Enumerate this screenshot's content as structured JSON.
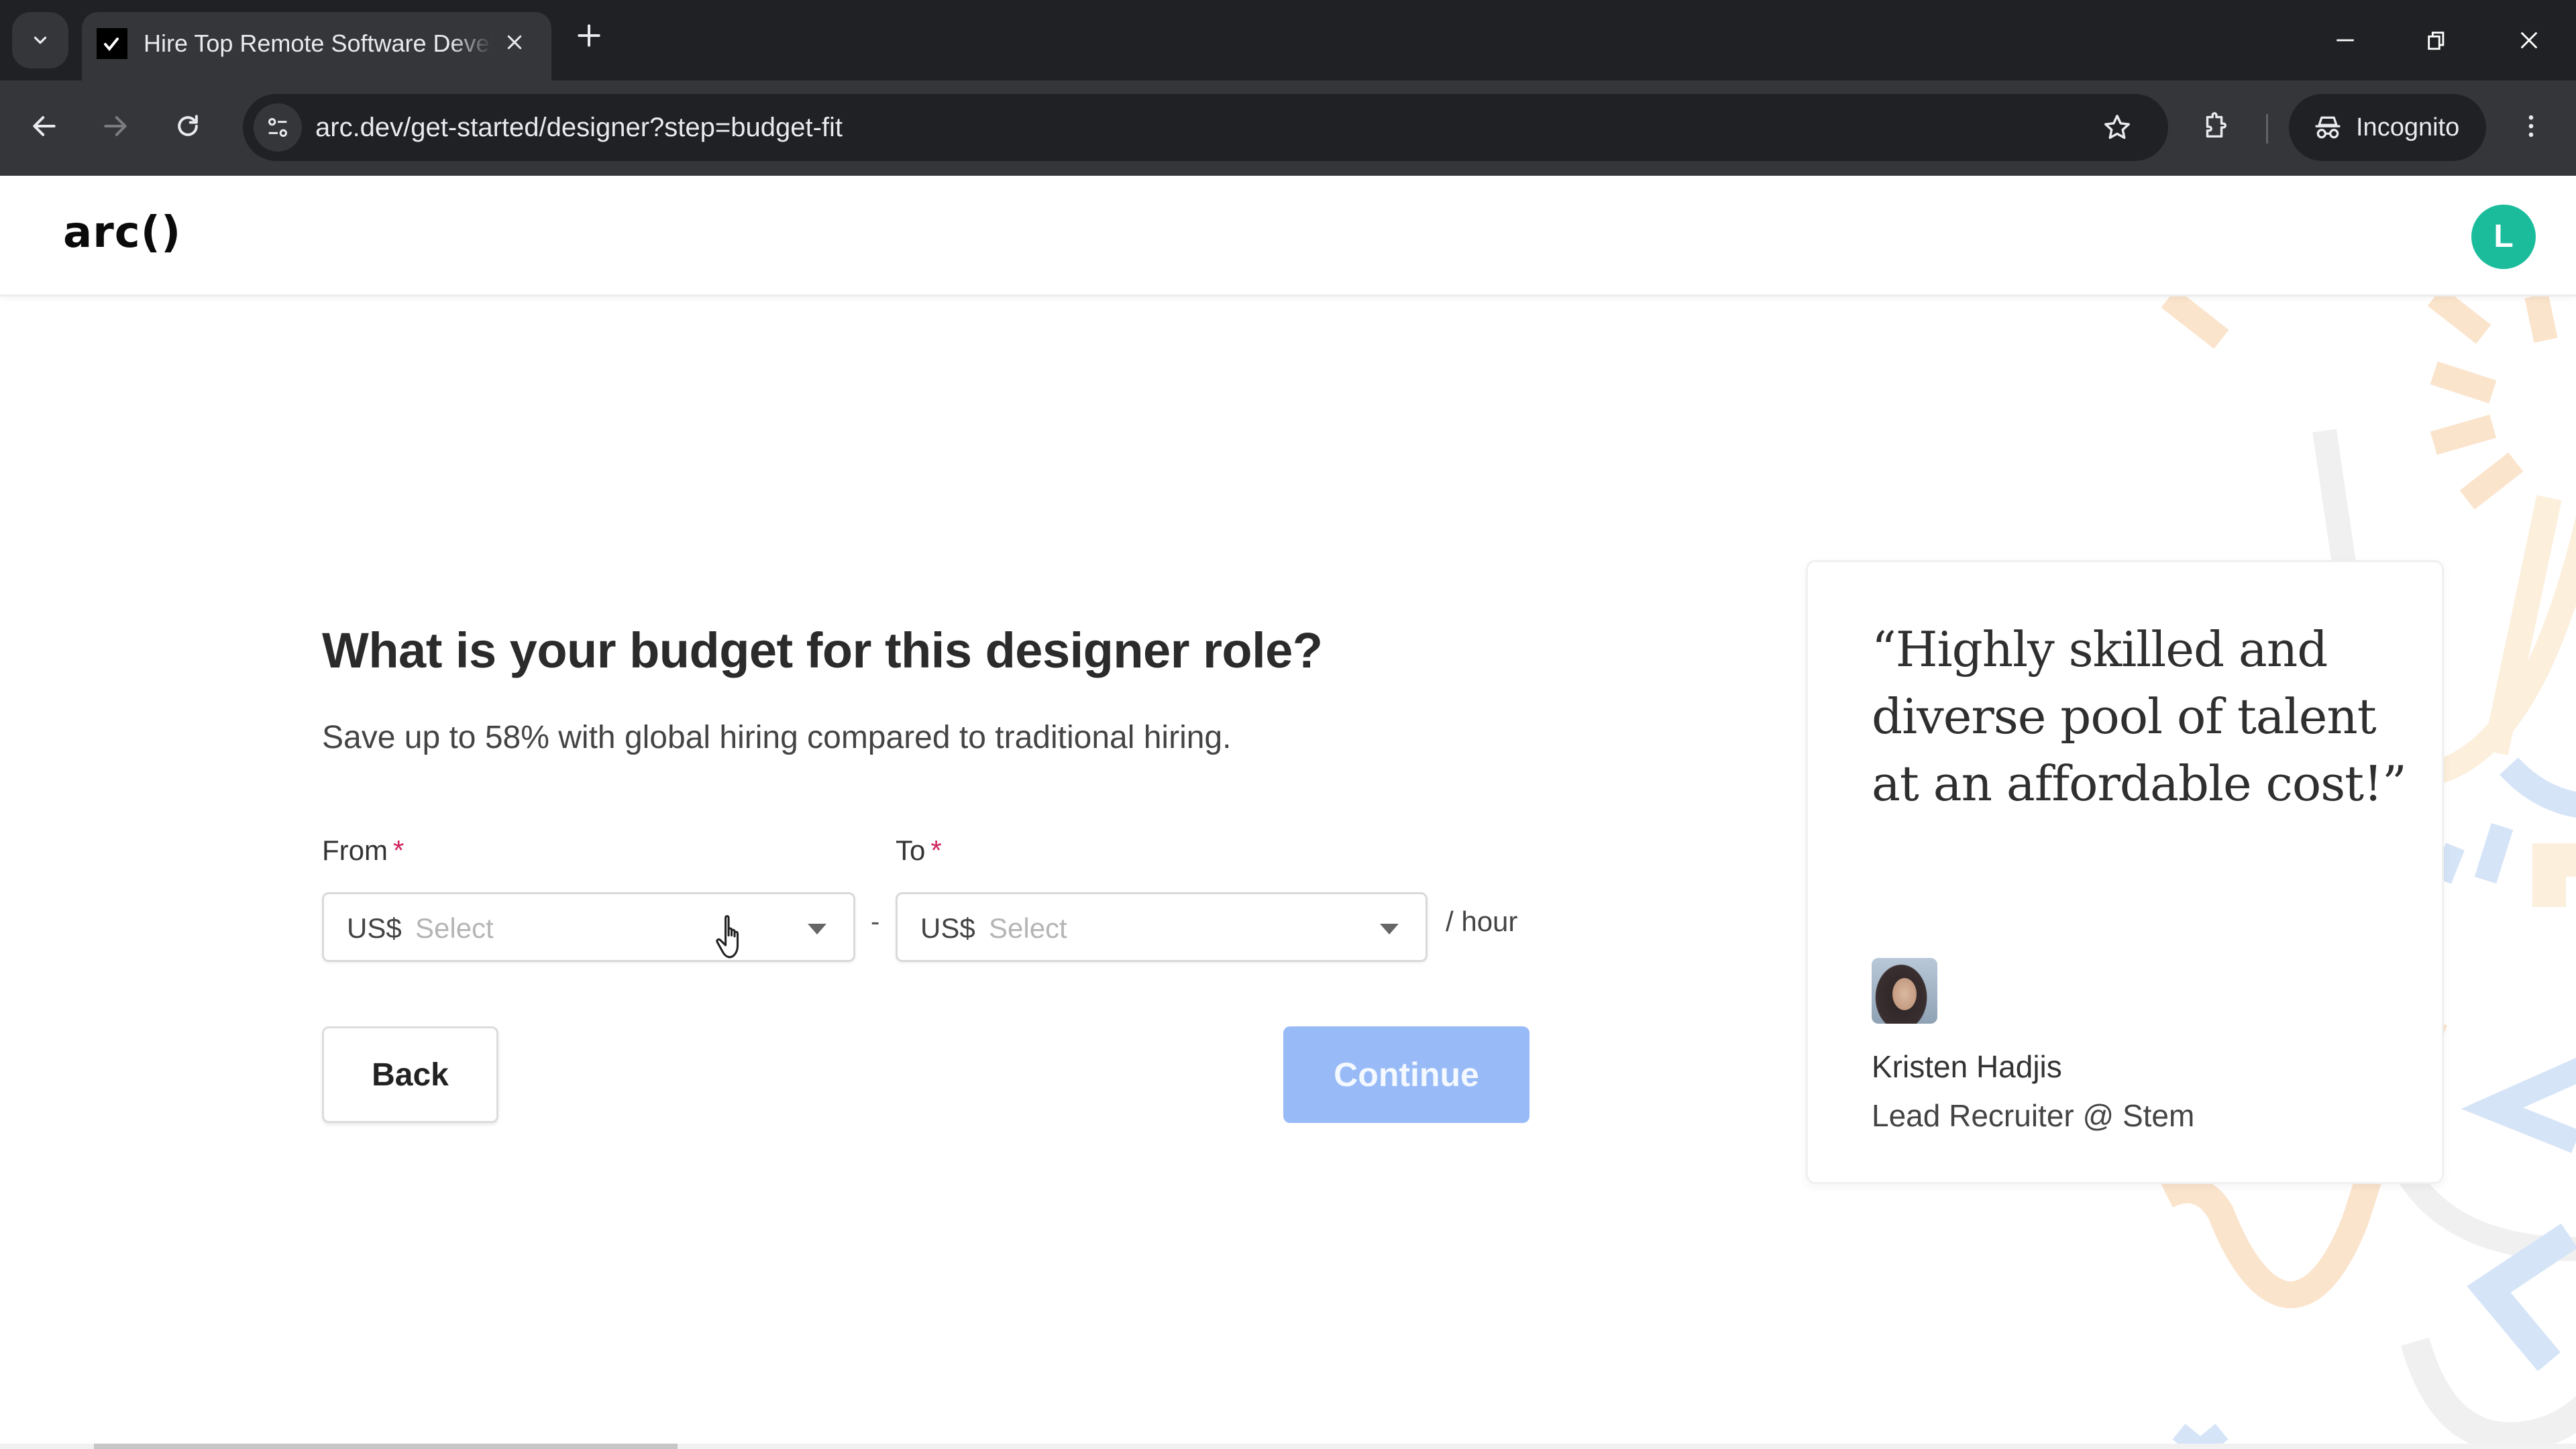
{
  "browser": {
    "tab": {
      "title": "Hire Top Remote Software Developers",
      "favicon": "arc-checkmark-icon"
    },
    "address_bar": {
      "url": "arc.dev/get-started/designer?step=budget-fit"
    },
    "profile": {
      "label": "Incognito"
    },
    "icons": {
      "tab_search": "chevron-down-icon",
      "tab_close": "close-icon",
      "new_tab": "plus-icon",
      "minimize": "minimize-icon",
      "restore": "restore-icon",
      "close_window": "close-icon",
      "back": "arrow-left-icon",
      "forward": "arrow-right-icon",
      "reload": "reload-icon",
      "site_info": "tune-icon",
      "bookmark": "star-icon",
      "extensions": "puzzle-icon",
      "incognito": "incognito-icon",
      "menu": "kebab-menu-icon"
    }
  },
  "header": {
    "logo": "arc()",
    "avatar_initial": "L",
    "avatar_color": "#1abc9c"
  },
  "form": {
    "heading": "What is your budget for this designer role?",
    "subtext": "Save up to 58% with global hiring compared to traditional hiring.",
    "from": {
      "label": "From",
      "required_marker": "*",
      "currency": "US$",
      "placeholder": "Select",
      "value": ""
    },
    "range_separator": "-",
    "to": {
      "label": "To",
      "required_marker": "*",
      "currency": "US$",
      "placeholder": "Select",
      "value": ""
    },
    "unit": "/ hour",
    "back_label": "Back",
    "continue_label": "Continue",
    "continue_color": "#98bbf7",
    "required_color": "#d0245c"
  },
  "testimonial": {
    "quote": "“Highly skilled and diverse pool of talent at an affordable cost!”",
    "name": "Kristen Hadjis",
    "role": "Lead Recruiter @ Stem"
  },
  "decoration_colors": {
    "peach": "#fbe4cc",
    "light_blue": "#d6e4f8",
    "light_gray": "#f0f0f0"
  }
}
